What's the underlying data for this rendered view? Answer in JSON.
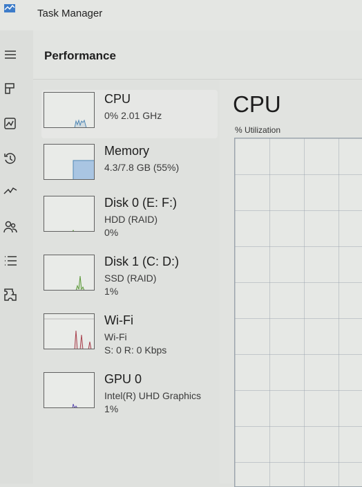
{
  "app": {
    "title": "Task Manager"
  },
  "nav": [
    {
      "name": "hamburger-menu-icon",
      "selected": false
    },
    {
      "name": "processes-icon",
      "selected": false
    },
    {
      "name": "performance-icon",
      "selected": true
    },
    {
      "name": "app-history-icon",
      "selected": false
    },
    {
      "name": "startup-apps-icon",
      "selected": false
    },
    {
      "name": "users-icon",
      "selected": false
    },
    {
      "name": "details-icon",
      "selected": false
    },
    {
      "name": "services-icon",
      "selected": false
    }
  ],
  "page": {
    "title": "Performance"
  },
  "sidebar": {
    "cards": [
      {
        "title": "CPU",
        "line1": "0% 2.01 GHz",
        "line2": "",
        "selected": true,
        "color": "#4f87b5"
      },
      {
        "title": "Memory",
        "line1": "4.3/7.8 GB (55%)",
        "line2": "",
        "selected": false,
        "color": "#4f87b5",
        "fill_fraction": 0.55
      },
      {
        "title": "Disk 0 (E: F:)",
        "line1": "HDD (RAID)",
        "line2": "0%",
        "selected": false,
        "color": "#5d9a3a"
      },
      {
        "title": "Disk 1 (C: D:)",
        "line1": "SSD (RAID)",
        "line2": "1%",
        "selected": false,
        "color": "#5d9a3a"
      },
      {
        "title": "Wi-Fi",
        "line1": "Wi-Fi",
        "line2": "S: 0 R: 0 Kbps",
        "selected": false,
        "color": "#a8424e"
      },
      {
        "title": "GPU 0",
        "line1": "Intel(R) UHD Graphics",
        "line2": "1%",
        "selected": false,
        "color": "#5b4ab0"
      }
    ]
  },
  "detail": {
    "title": "CPU",
    "subtitle": "% Utilization"
  }
}
